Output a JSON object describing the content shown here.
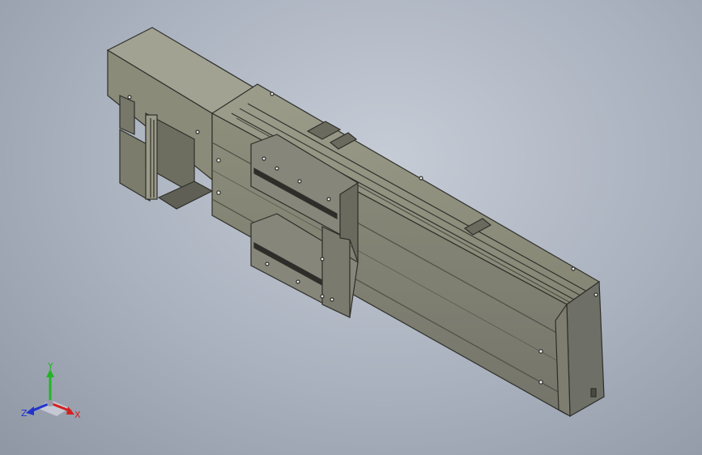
{
  "viewport": {
    "background_top": "#c6ccd6",
    "background_bottom": "#8f97a5"
  },
  "model": {
    "body_color": "#8a8a78",
    "dark_edge_color": "#2e2f2a",
    "end_cap_color": "#6e6f66"
  },
  "triad": {
    "x_label": "X",
    "y_label": "Y",
    "z_label": "Z",
    "x_color": "#d42020",
    "y_color": "#22b522",
    "z_color": "#2233cc"
  }
}
